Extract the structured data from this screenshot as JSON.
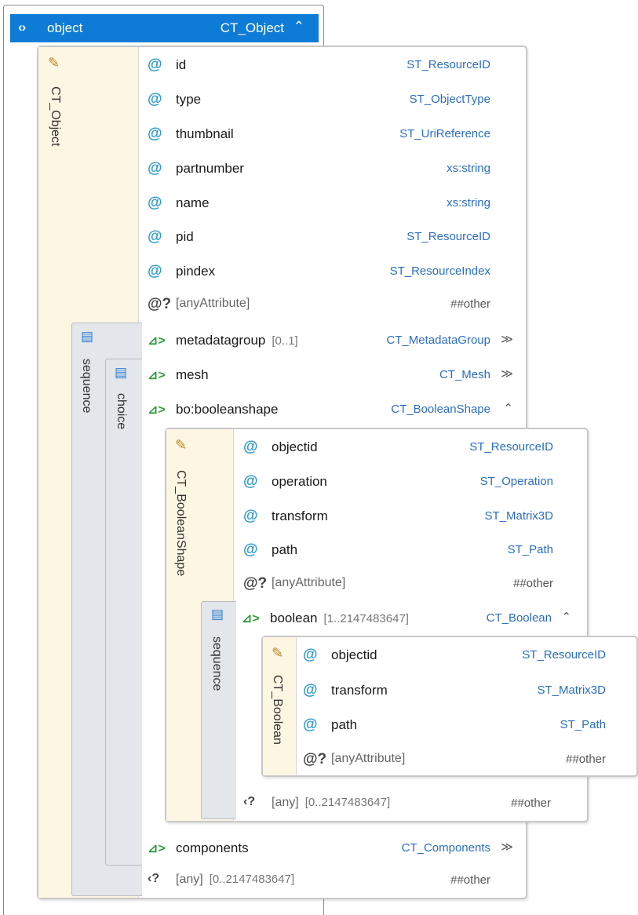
{
  "root": {
    "icon": "‹›",
    "name": "object",
    "type": "CT_Object",
    "chevron": "⌃"
  },
  "ct_object": {
    "label": "CT_Object",
    "attributes": [
      {
        "name": "id",
        "type": "ST_ResourceID"
      },
      {
        "name": "type",
        "type": "ST_ObjectType"
      },
      {
        "name": "thumbnail",
        "type": "ST_UriReference"
      },
      {
        "name": "partnumber",
        "type": "xs:string"
      },
      {
        "name": "name",
        "type": "xs:string"
      },
      {
        "name": "pid",
        "type": "ST_ResourceID"
      },
      {
        "name": "pindex",
        "type": "ST_ResourceIndex"
      }
    ],
    "any_attribute": {
      "name": "[anyAttribute]",
      "type": "##other"
    },
    "sequence_label": "sequence",
    "choice_label": "choice",
    "metadatagroup": {
      "name": "metadatagroup",
      "occurs": "[0..1]",
      "type": "CT_MetadataGroup",
      "chevron": "≫"
    },
    "mesh": {
      "name": "mesh",
      "type": "CT_Mesh",
      "chevron": "≫"
    },
    "booleanshape": {
      "name": "bo:booleanshape",
      "type": "CT_BooleanShape",
      "chevron": "⌃"
    },
    "components": {
      "name": "components",
      "type": "CT_Components",
      "chevron": "≫"
    },
    "any": {
      "name": "[any]",
      "occurs": "[0..2147483647]",
      "type": "##other"
    }
  },
  "ct_booleanshape": {
    "label": "CT_BooleanShape",
    "attributes": [
      {
        "name": "objectid",
        "type": "ST_ResourceID"
      },
      {
        "name": "operation",
        "type": "ST_Operation"
      },
      {
        "name": "transform",
        "type": "ST_Matrix3D"
      },
      {
        "name": "path",
        "type": "ST_Path"
      }
    ],
    "any_attribute": {
      "name": "[anyAttribute]",
      "type": "##other"
    },
    "sequence_label": "sequence",
    "boolean": {
      "name": "boolean",
      "occurs": "[1..2147483647]",
      "type": "CT_Boolean",
      "chevron": "⌃"
    },
    "any": {
      "name": "[any]",
      "occurs": "[0..2147483647]",
      "type": "##other"
    }
  },
  "ct_boolean": {
    "label": "CT_Boolean",
    "attributes": [
      {
        "name": "objectid",
        "type": "ST_ResourceID"
      },
      {
        "name": "transform",
        "type": "ST_Matrix3D"
      },
      {
        "name": "path",
        "type": "ST_Path"
      }
    ],
    "any_attribute": {
      "name": "[anyAttribute]",
      "type": "##other"
    }
  },
  "icons": {
    "attribute": "@",
    "any_attribute": "@?",
    "element": "⊿>",
    "any_element": "‹?",
    "label_icon": "✎",
    "sequence_icon": "▤"
  }
}
